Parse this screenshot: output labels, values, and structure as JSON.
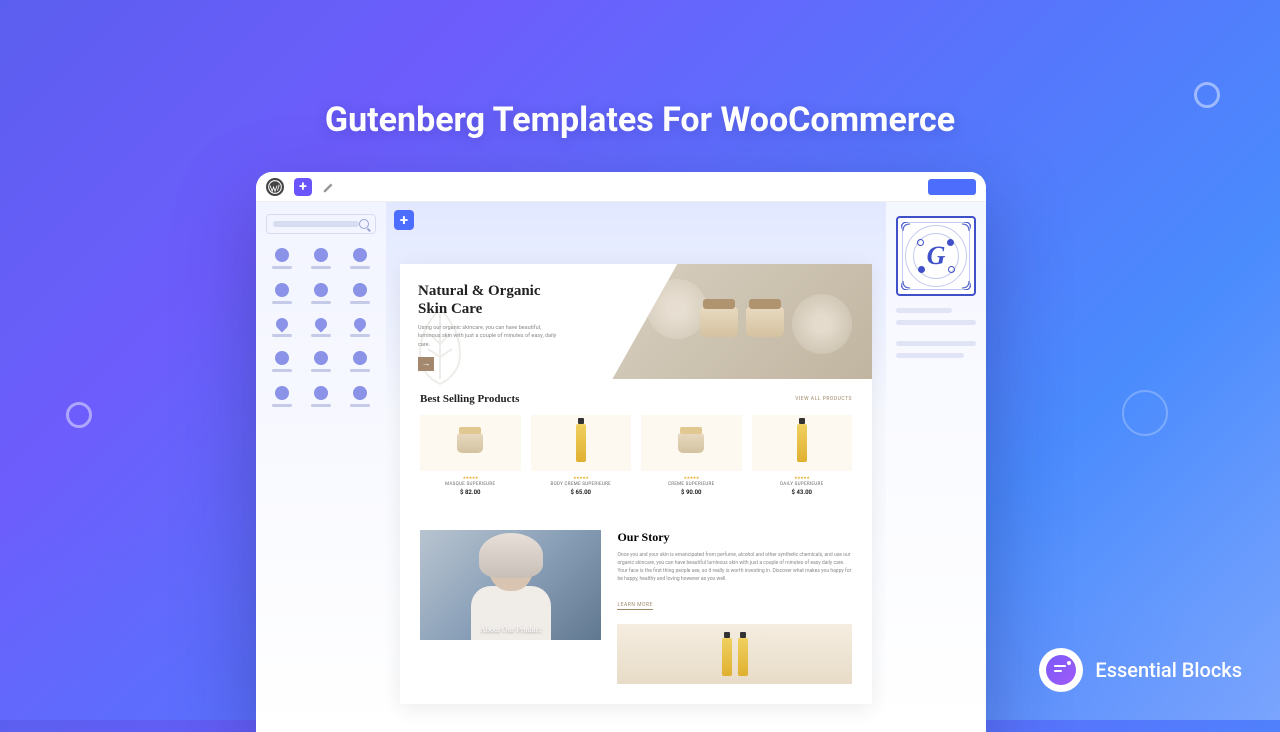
{
  "headline": "Gutenberg Templates For WooCommerce",
  "brand": {
    "name": "Essential Blocks"
  },
  "editor": {
    "logo_letter": "G",
    "hero": {
      "title_line1": "Natural & Organic",
      "title_line2": "Skin Care",
      "body": "Using our organic skincare, you can have beautiful, luminous skin with just a couple of minutes of easy, daily care."
    },
    "best_selling": {
      "title": "Best Selling Products",
      "view_all": "VIEW ALL PRODUCTS",
      "products": [
        {
          "name": "MASQUE SUPERIEURE",
          "price": "$ 82.00"
        },
        {
          "name": "BODY CREME SUPERIEURE",
          "price": "$ 65.00"
        },
        {
          "name": "CREME SUPERIEURE",
          "price": "$ 90.00"
        },
        {
          "name": "DAILY SUPERIEURE",
          "price": "$ 43.00"
        }
      ]
    },
    "story": {
      "title": "Our Story",
      "body": "Once you and your skin is emancipated from perfume, alcohol and other synthetic chemicals, and use our organic skincare, you can have beautiful luminous skin with just a couple of minutes of easy daily care. Your face is the first thing people see, so it really is worth investing in. Discover what makes you happy for be happy, healthy and loving however as you well.",
      "link": "LEARN MORE",
      "caption": "About Our Product"
    }
  }
}
